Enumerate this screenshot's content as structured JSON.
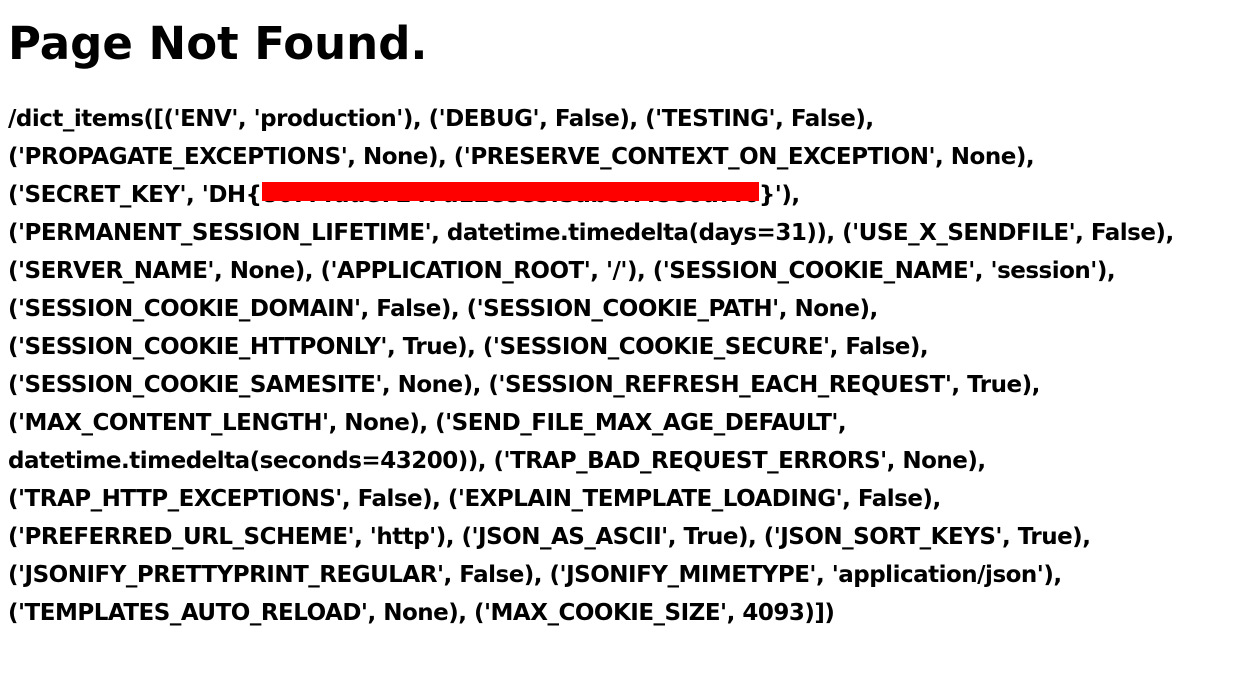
{
  "page": {
    "title": "Page Not Found."
  },
  "error_message": {
    "lines": [
      "/dict_items([('ENV', 'production'), ('DEBUG', False), ('TESTING', False),",
      "('PROPAGATE_EXCEPTIONS', None), ('PRESERVE_CONTEXT_ON_EXCEPTION', None),",
      "('PERMANENT_SESSION_LIFETIME', datetime.timedelta(days=31)), ('USE_X_SENDFILE', False),",
      "('SERVER_NAME', None), ('APPLICATION_ROOT', '/'), ('SESSION_COOKIE_NAME', 'session'),",
      "('SESSION_COOKIE_DOMAIN', False), ('SESSION_COOKIE_PATH', None),",
      "('SESSION_COOKIE_HTTPONLY', True), ('SESSION_COOKIE_SECURE', False),",
      "('SESSION_COOKIE_SAMESITE', None), ('SESSION_REFRESH_EACH_REQUEST', True),",
      "('MAX_CONTENT_LENGTH', None), ('SEND_FILE_MAX_AGE_DEFAULT',",
      "datetime.timedelta(seconds=43200)), ('TRAP_BAD_REQUEST_ERRORS', None),",
      "('TRAP_HTTP_EXCEPTIONS', False), ('EXPLAIN_TEMPLATE_LOADING', False),",
      "('PREFERRED_URL_SCHEME', 'http'), ('JSON_AS_ASCII', True), ('JSON_SORT_KEYS', True),",
      "('JSONIFY_PRETTYPRINT_REGULAR', False), ('JSONIFY_MIMETYPE', 'application/json'),",
      "('TEMPLATES_AUTO_RELOAD', None), ('MAX_COOKIE_SIZE', 4093)])"
    ],
    "secret_key_line": {
      "prefix": "('SECRET_KEY', 'DH{",
      "redacted_text": "867f4dde7247d12e8e5f3ab5f7f5e6d7f6",
      "suffix": "}'),",
      "redaction_color": "#ff0000"
    }
  }
}
